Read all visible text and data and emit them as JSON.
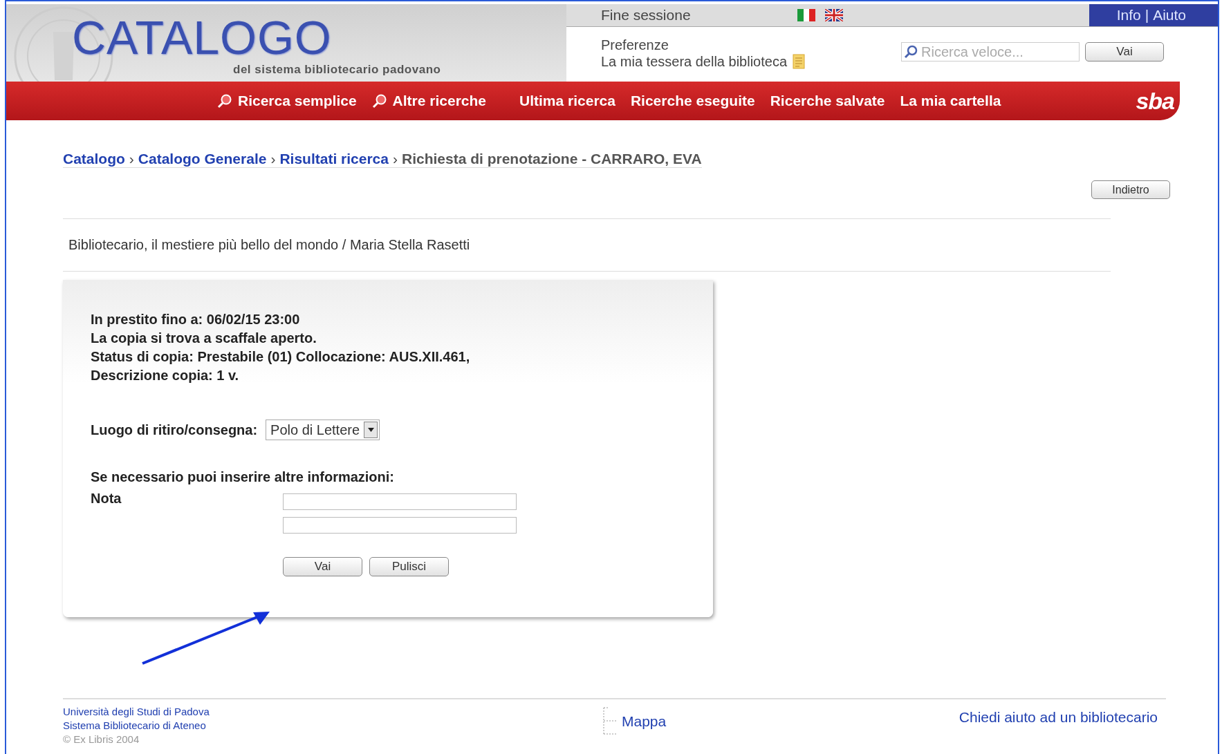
{
  "header": {
    "logo_title": "CATALOGO",
    "logo_subtitle": "del sistema bibliotecario padovano",
    "session_link": "Fine sessione",
    "help_links": [
      "Info",
      "Aiuto"
    ],
    "help_separator": "|",
    "user_links": [
      "Preferenze",
      "La mia tessera della biblioteca"
    ],
    "quick_search": {
      "placeholder": "Ricerca veloce...",
      "button": "Vai"
    }
  },
  "nav": {
    "items": [
      {
        "label": "Ricerca semplice",
        "icon": true
      },
      {
        "label": "Altre ricerche",
        "icon": true
      },
      {
        "label": "Ultima ricerca",
        "icon": false
      },
      {
        "label": "Ricerche eseguite",
        "icon": false
      },
      {
        "label": "Ricerche salvate",
        "icon": false
      },
      {
        "label": "La mia cartella",
        "icon": false
      }
    ],
    "logo": "sba"
  },
  "breadcrumb": {
    "links": [
      "Catalogo",
      "Catalogo Generale",
      "Risultati ricerca"
    ],
    "current": "Richiesta di prenotazione - CARRARO, EVA",
    "separator": "›"
  },
  "back_button": "Indietro",
  "record_title": "Bibliotecario, il mestiere più bello del mondo / Maria Stella Rasetti",
  "request_form": {
    "info_lines": [
      "In prestito fino a: 06/02/15 23:00",
      "La copia si trova a scaffale aperto.",
      "Status di copia: Prestabile (01) Collocazione: AUS.XII.461,",
      "Descrizione copia: 1 v."
    ],
    "pickup_label": "Luogo di ritiro/consegna:",
    "pickup_value": "Polo di Lettere",
    "extra_label": "Se necessario puoi inserire altre informazioni:",
    "note_label": "Nota",
    "buttons": [
      "Vai",
      "Pulisci"
    ]
  },
  "footer": {
    "left_links": [
      "Università degli Studi di Padova",
      "Sistema Bibliotecario di Ateneo"
    ],
    "copyright": "© Ex Libris 2004",
    "map_link": "Mappa",
    "help_link": "Chiedi aiuto ad un bibliotecario"
  }
}
